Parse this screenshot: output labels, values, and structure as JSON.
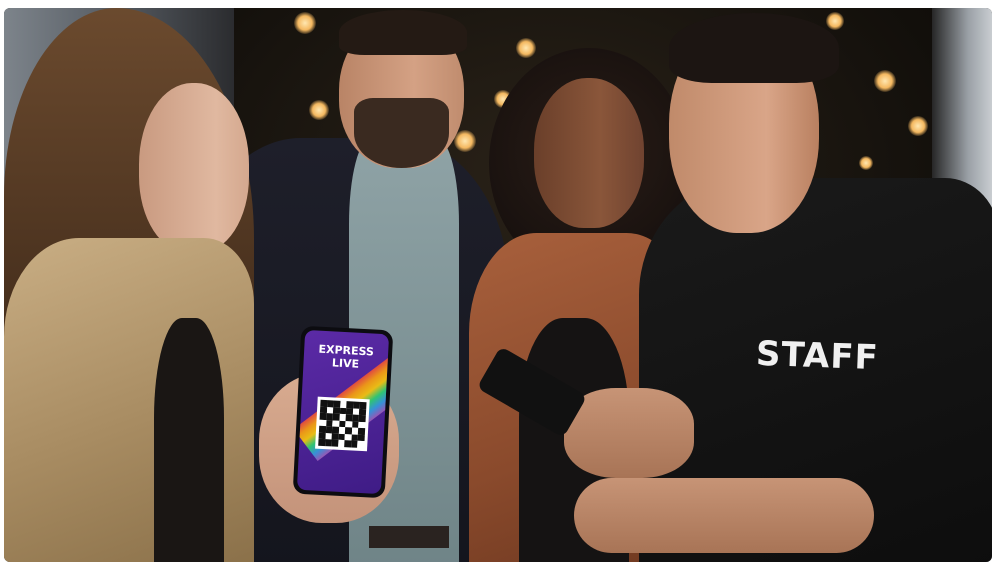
{
  "photo": {
    "description_hidden": "",
    "phone_screen": {
      "brand_line1": "EXPRESS",
      "brand_line2": "LIVE"
    },
    "shirt_print": "STAFF"
  }
}
